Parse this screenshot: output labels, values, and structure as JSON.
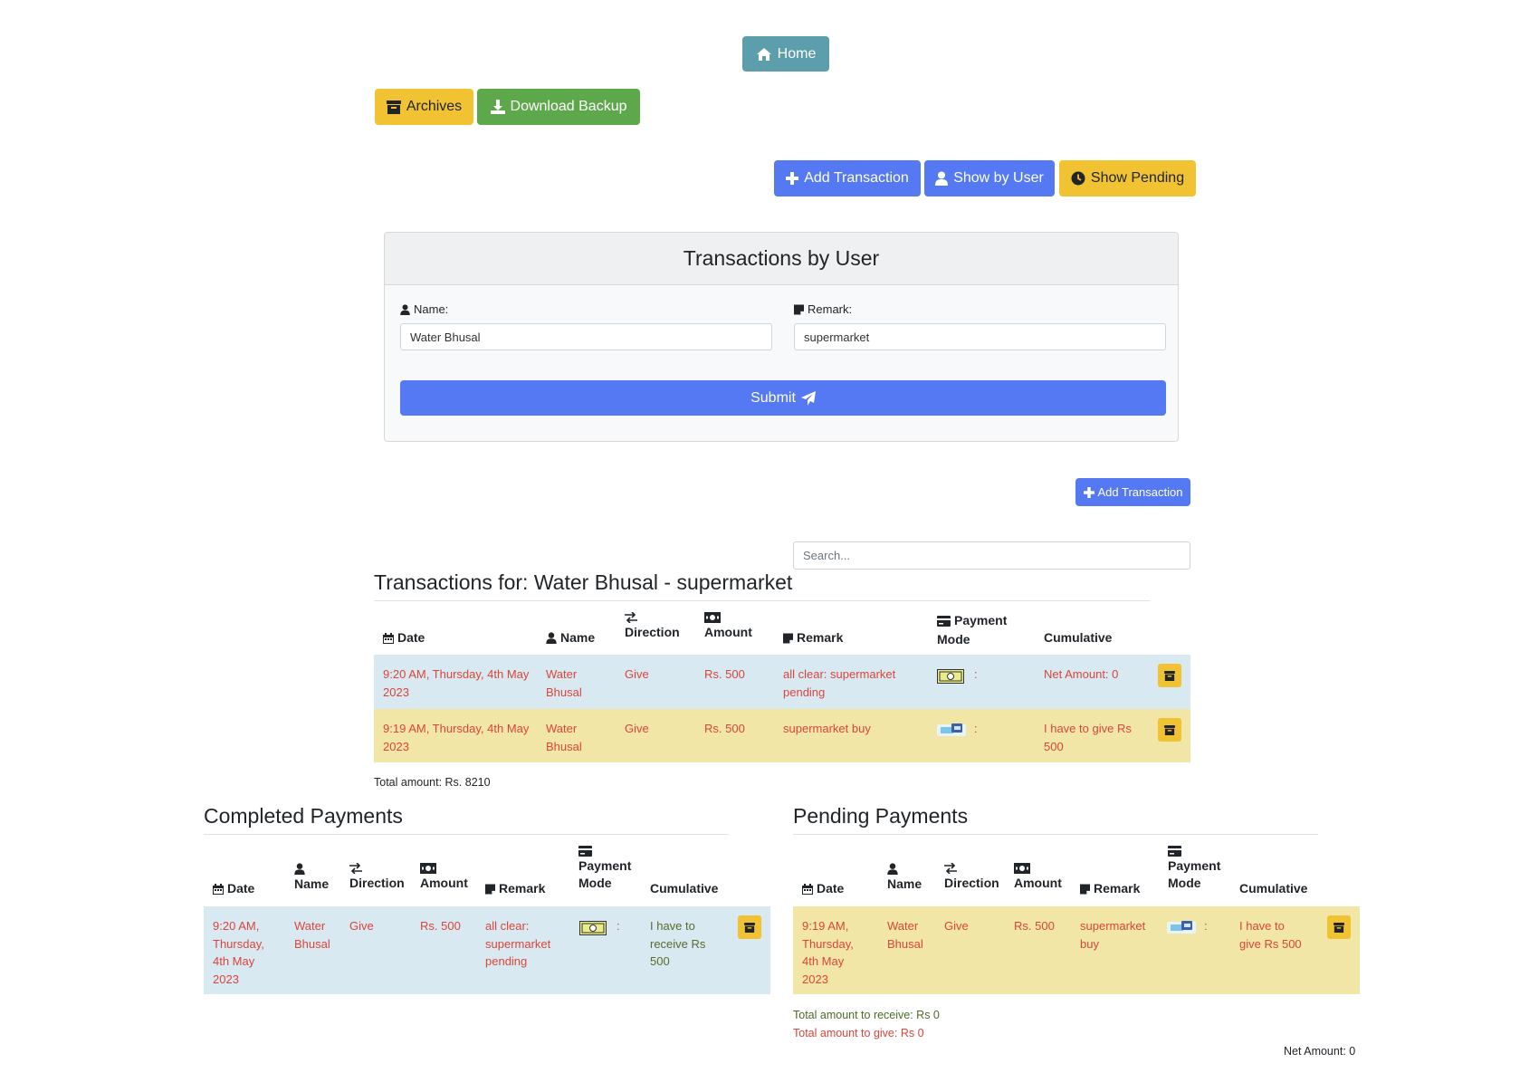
{
  "nav": {
    "home_label": "Home"
  },
  "actions": {
    "archives_label": "Archives",
    "download_label": "Download Backup"
  },
  "toolbar": {
    "add_label": "Add Transaction",
    "show_user_label": "Show by User",
    "show_pending_label": "Show Pending"
  },
  "form": {
    "title": "Transactions by User",
    "name_label": "Name:",
    "name_value": "Water Bhusal",
    "remark_label": "Remark:",
    "remark_value": "supermarket",
    "submit_label": "Submit"
  },
  "add_small_label": "Add Transaction",
  "search": {
    "placeholder": "Search..."
  },
  "transactions": {
    "title": "Transactions for: Water Bhusal - supermarket",
    "headers": {
      "date": "Date",
      "name": "Name",
      "direction": "Direction",
      "amount": "Amount",
      "remark": "Remark",
      "payment1": "Payment",
      "payment2": "Mode",
      "cumulative": "Cumulative"
    },
    "rows": [
      {
        "date": "9:20 AM, Thursday, 4th May 2023",
        "name": "Water Bhusal",
        "direction": "Give",
        "amount": "Rs. 500",
        "remark": "all clear: supermarket pending",
        "mode": "cash",
        "sep": ":",
        "cumulative": "Net Amount: 0"
      },
      {
        "date": "9:19 AM, Thursday, 4th May 2023",
        "name": "Water Bhusal",
        "direction": "Give",
        "amount": "Rs. 500",
        "remark": "supermarket buy",
        "mode": "card",
        "sep": ":",
        "cumulative": "I have to give Rs 500"
      }
    ],
    "total": "Total amount: Rs. 8210"
  },
  "completed": {
    "title": "Completed Payments",
    "row": {
      "date": "9:20 AM, Thursday, 4th May 2023",
      "name": "Water Bhusal",
      "direction": "Give",
      "amount": "Rs. 500",
      "remark": "all clear: supermarket pending",
      "mode": "cash",
      "sep": ":",
      "cumulative": "I have to receive Rs 500"
    }
  },
  "pending": {
    "title": "Pending Payments",
    "row": {
      "date": "9:19 AM, Thursday, 4th May 2023",
      "name": "Water Bhusal",
      "direction": "Give",
      "amount": "Rs. 500",
      "remark": "supermarket buy",
      "mode": "card",
      "sep": ":",
      "cumulative": "I have to give Rs 500"
    },
    "to_receive": "Total amount to receive: Rs 0",
    "to_give": "Total amount to give: Rs 0",
    "net": "Net Amount: 0"
  },
  "colors": {
    "primary": "#5479f2",
    "warning": "#f1c232",
    "success": "#5ea84c",
    "info": "#5d9eac",
    "danger_text": "#d9453b",
    "row_blue": "#d9e9f1",
    "row_yellow": "#f2e6a6"
  },
  "icons": [
    "home-icon",
    "archive-icon",
    "download-icon",
    "plus-icon",
    "user-icon",
    "clock-icon",
    "note-icon",
    "send-icon",
    "calendar-icon",
    "exchange-icon",
    "money-icon",
    "credit-card-icon",
    "cash-note-icon",
    "card-icon"
  ]
}
